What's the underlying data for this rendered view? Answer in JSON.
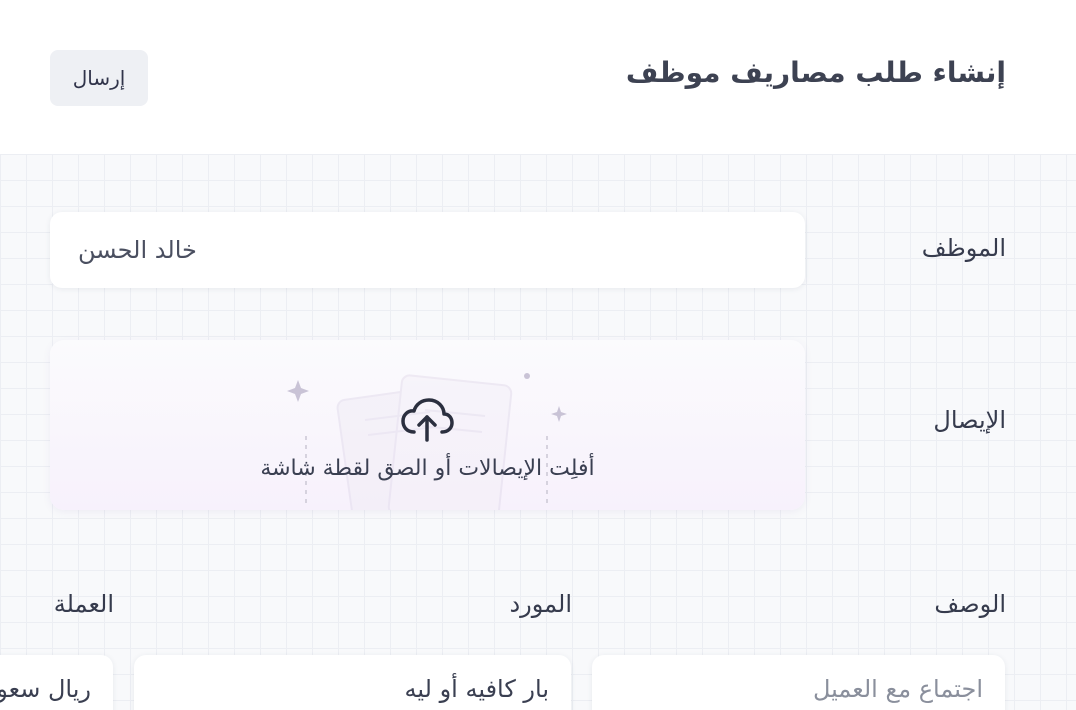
{
  "header": {
    "title": "إنشاء طلب مصاريف موظف",
    "send_label": "إرسال"
  },
  "employee": {
    "label": "الموظف",
    "value": "خالد الحسن"
  },
  "receipt": {
    "label": "الإيصال",
    "dropzone_text": "أفلِت الإيصالات أو الصق لقطة شاشة",
    "icon": "cloud-upload-icon"
  },
  "description": {
    "label": "الوصف",
    "placeholder": "اجتماع مع العميل"
  },
  "vendor": {
    "label": "المورد",
    "value": "بار كافيه أو ليه"
  },
  "currency": {
    "label": "العملة",
    "value": "ريال سعودي"
  },
  "colors": {
    "background_grid": "#f8f9fb",
    "grid_line": "#eceef3",
    "dropzone_tint": "#f7f1fc",
    "button_bg": "#eef0f4",
    "text": "#3a3f51"
  }
}
